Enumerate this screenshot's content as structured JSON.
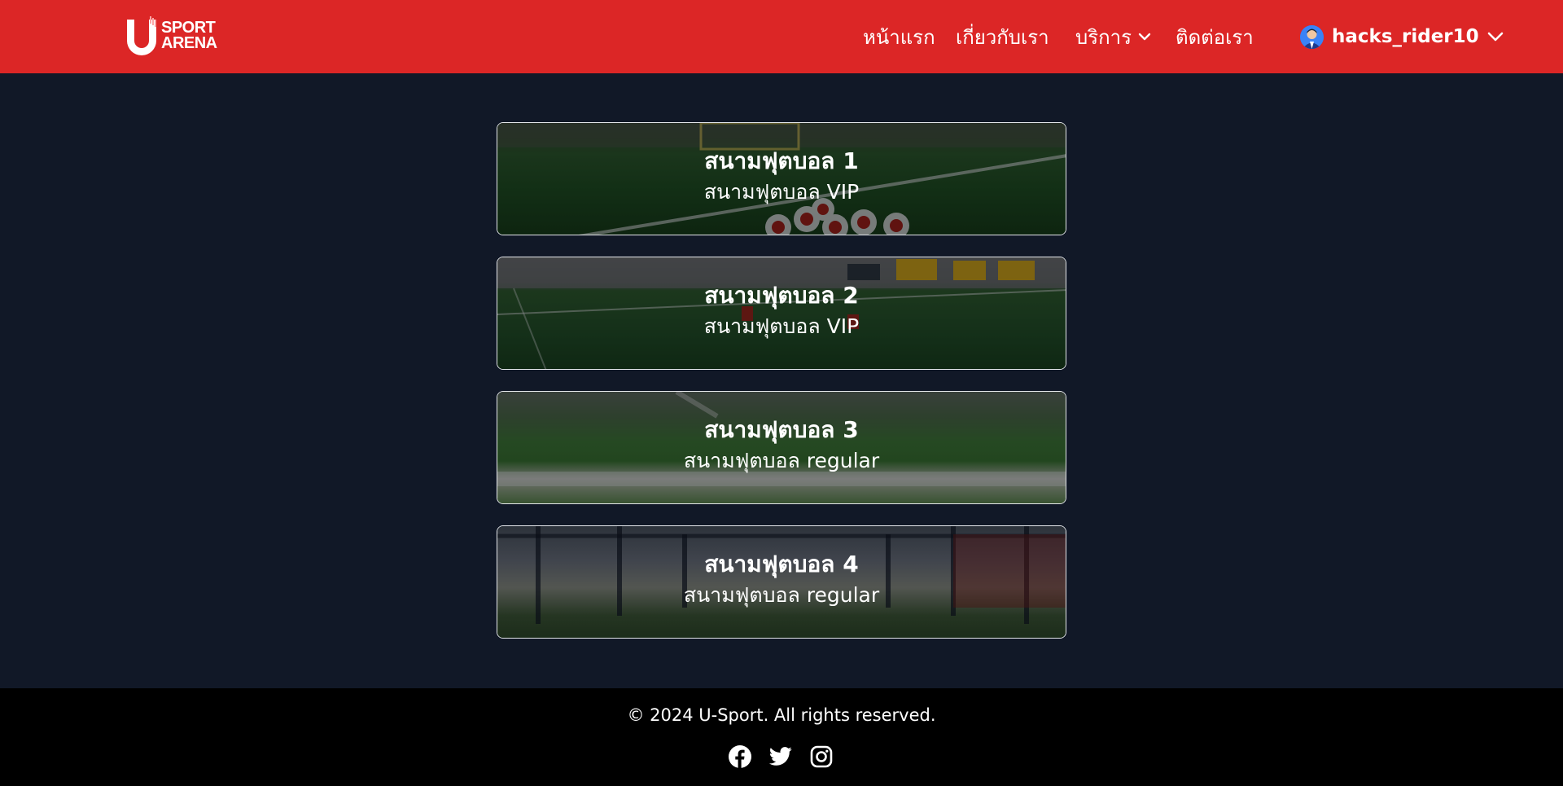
{
  "brand": {
    "logo_letter": "U",
    "line1": "SPORT",
    "line2": "ARENA"
  },
  "nav": {
    "home": "หน้าแรก",
    "about": "เกี่ยวกับเรา",
    "services": "บริการ",
    "contact": "ติดต่อเรา"
  },
  "user": {
    "name": "hacks_rider10"
  },
  "fields": [
    {
      "title": "สนามฟุตบอล 1",
      "subtitle": "สนามฟุตบอล VIP"
    },
    {
      "title": "สนามฟุตบอล 2",
      "subtitle": "สนามฟุตบอล VIP"
    },
    {
      "title": "สนามฟุตบอล 3",
      "subtitle": "สนามฟุตบอล regular"
    },
    {
      "title": "สนามฟุตบอล 4",
      "subtitle": "สนามฟุตบอล regular"
    }
  ],
  "footer": {
    "copyright": "© 2024 U-Sport. All rights reserved."
  },
  "socials": [
    "facebook-icon",
    "twitter-icon",
    "instagram-icon"
  ],
  "colors": {
    "header_bg": "#dc2626",
    "page_bg": "#111827",
    "footer_bg": "#000000",
    "card_border": "#e5e7eb"
  }
}
